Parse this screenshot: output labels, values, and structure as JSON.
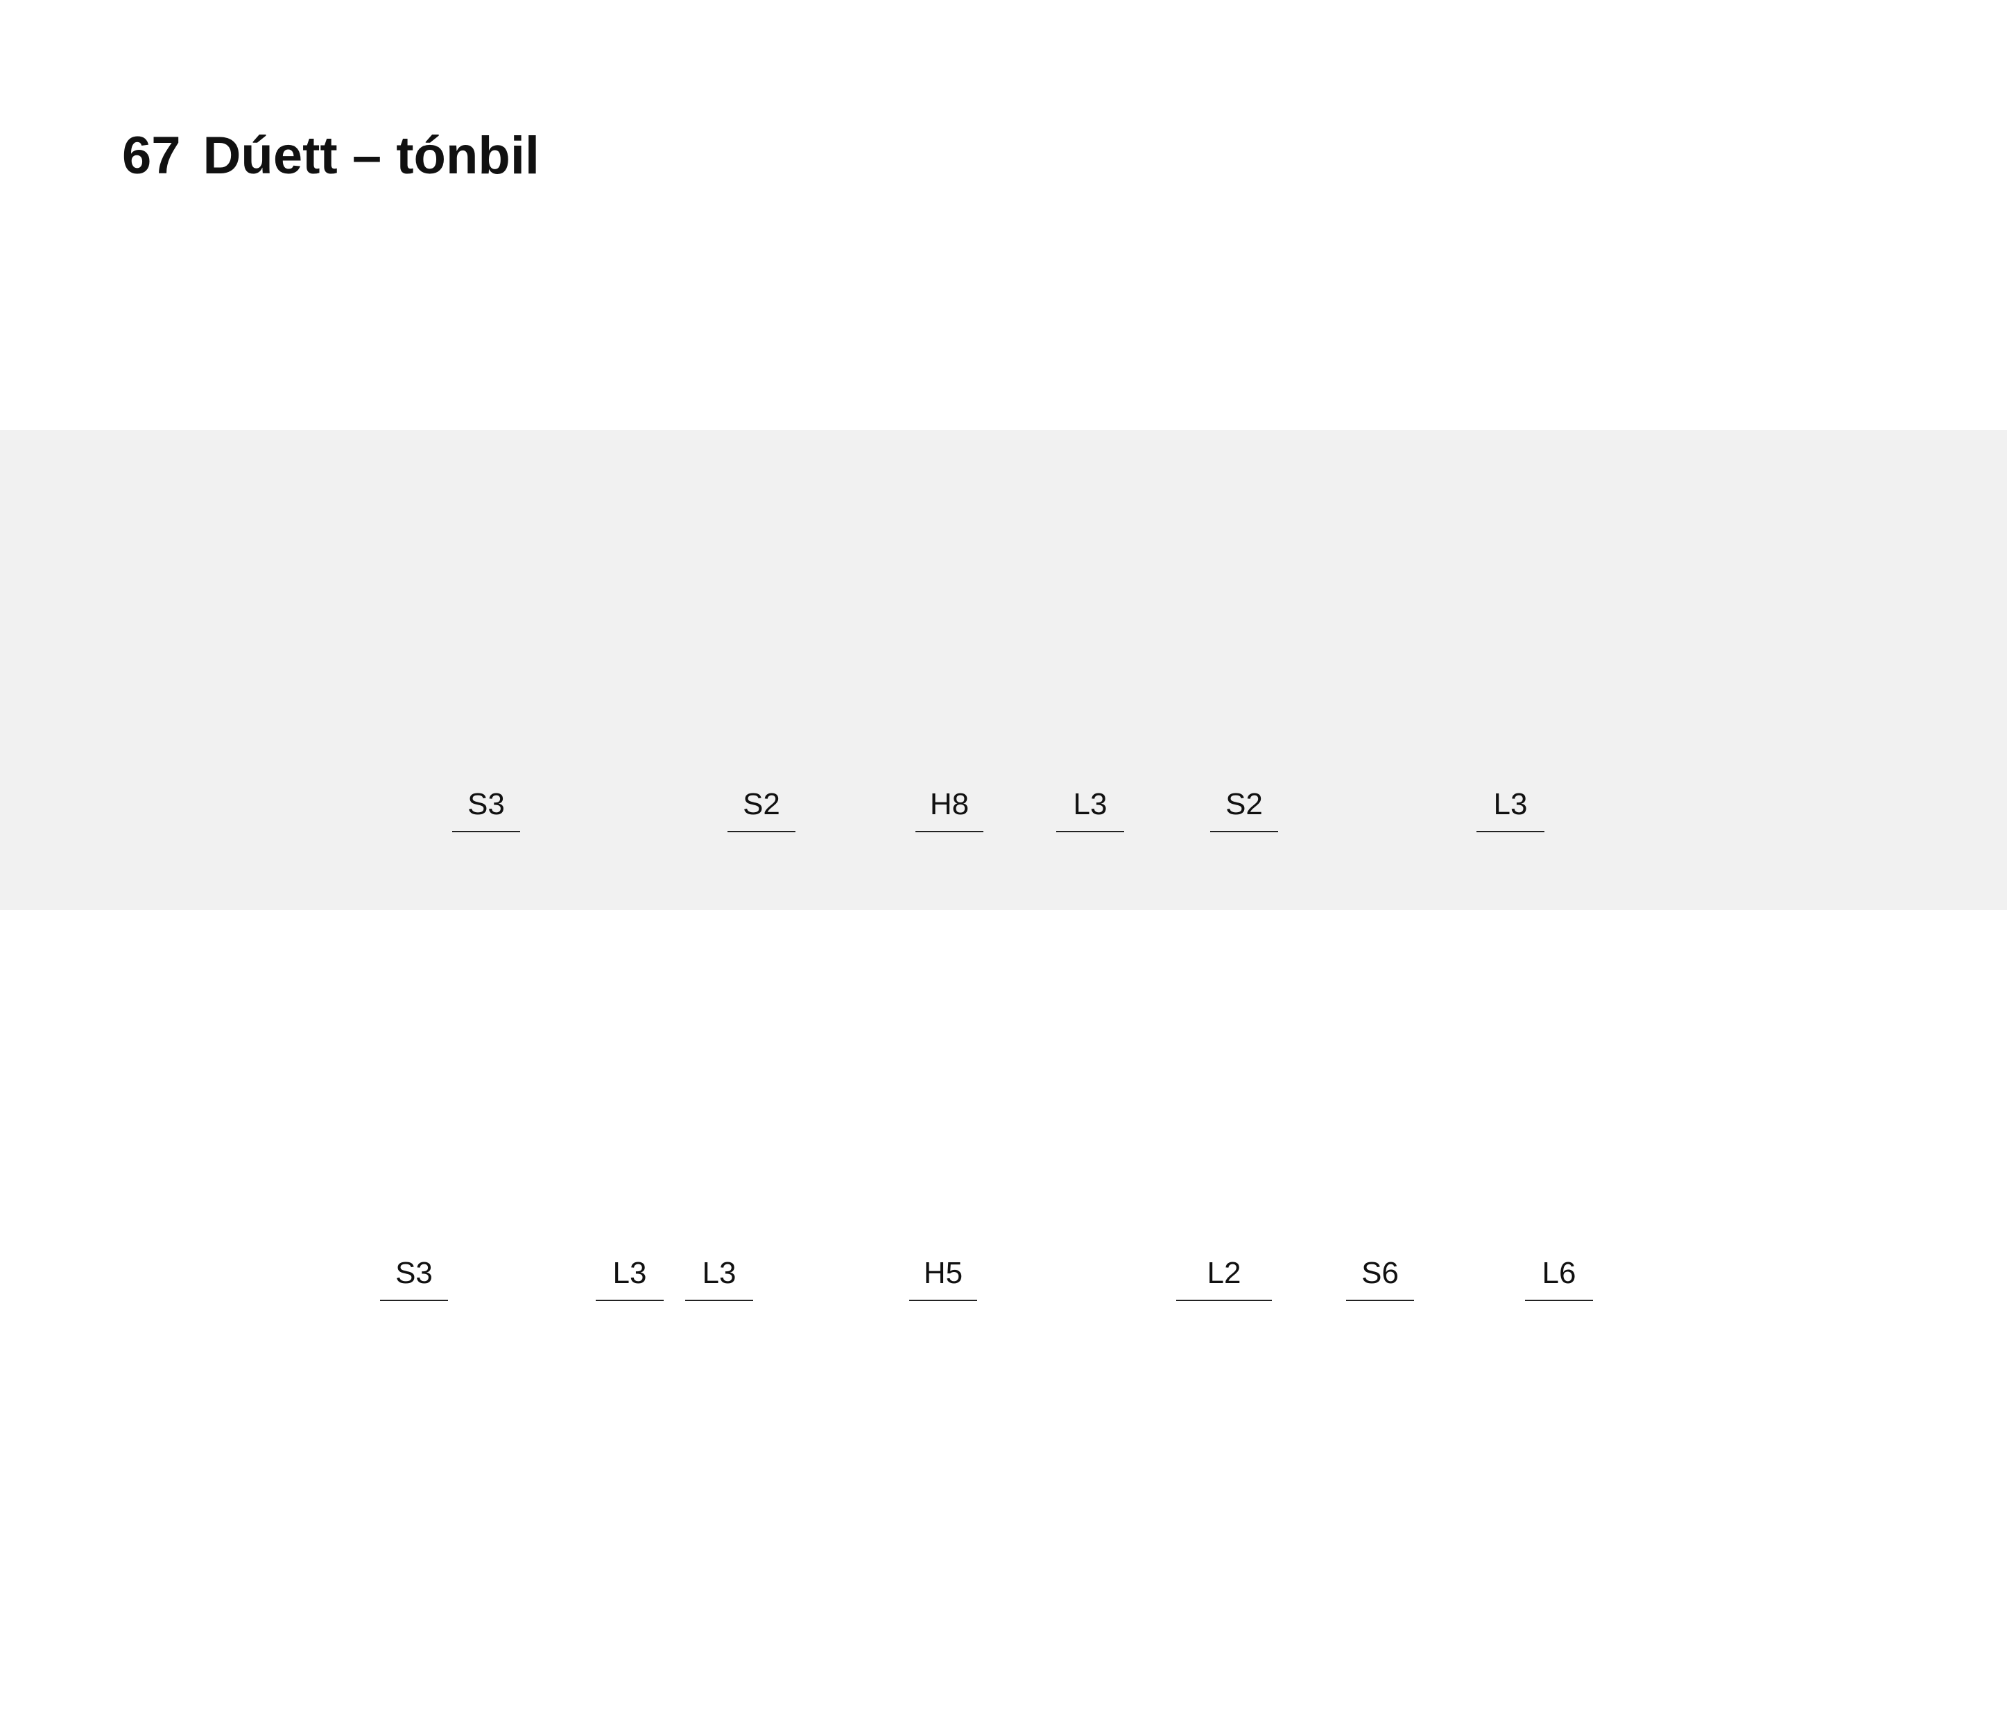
{
  "page": {
    "number": "67",
    "title": "Dúett – tónbil"
  },
  "rows": [
    {
      "items": [
        {
          "label": "S3"
        },
        {
          "label": "S2"
        },
        {
          "label": "H8"
        },
        {
          "label": "L3"
        },
        {
          "label": "S2"
        },
        {
          "label": "L3"
        }
      ]
    },
    {
      "items": [
        {
          "label": "S3"
        },
        {
          "label": "L3"
        },
        {
          "label": "L3"
        },
        {
          "label": "H5"
        },
        {
          "label": "L2"
        },
        {
          "label": "S6"
        },
        {
          "label": "L6"
        }
      ]
    }
  ],
  "colors": {
    "band_background": "#f1f1f1",
    "text": "#111111",
    "line": "#222222"
  }
}
